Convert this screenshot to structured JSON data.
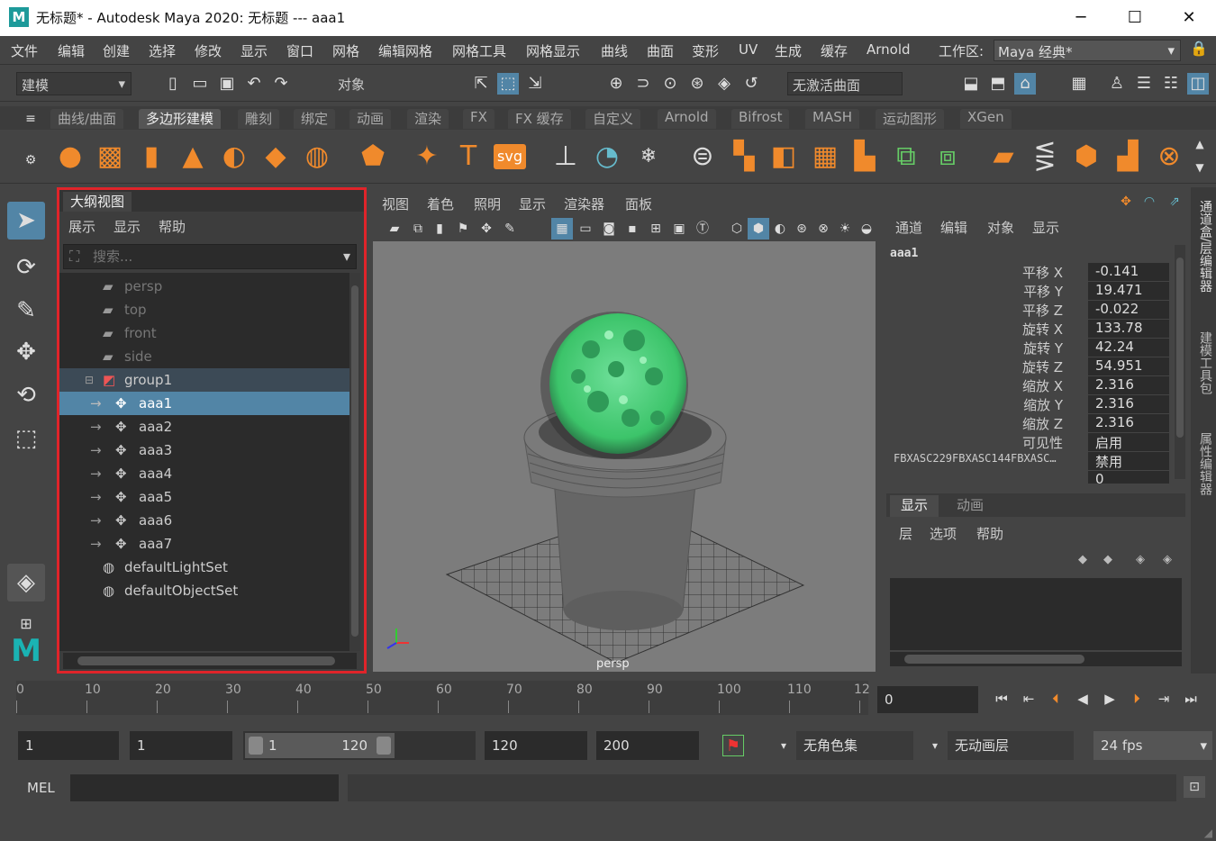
{
  "window": {
    "title": "无标题* - Autodesk Maya 2020: 无标题   ---    aaa1",
    "logo": "M",
    "minimize": "─",
    "maximize": "☐",
    "close": "✕"
  },
  "menus": [
    "文件",
    "编辑",
    "创建",
    "选择",
    "修改",
    "显示",
    "窗口",
    "网格",
    "编辑网格",
    "网格工具",
    "网格显示",
    "曲线",
    "曲面",
    "变形",
    "UV",
    "生成",
    "缓存",
    "Arnold"
  ],
  "workspace": {
    "label": "工作区:",
    "value": "Maya 经典*"
  },
  "toolbar": {
    "mode": "建模",
    "object_mode": "对象",
    "live_surface": "无激活曲面"
  },
  "shelf_tabs": [
    "曲线/曲面",
    "多边形建模",
    "雕刻",
    "绑定",
    "动画",
    "渲染",
    "FX",
    "FX 缓存",
    "自定义",
    "Arnold",
    "Bifrost",
    "MASH",
    "运动图形",
    "XGen"
  ],
  "shelf_active": "多边形建模",
  "outliner": {
    "title": "大纲视图",
    "menu": [
      "展示",
      "显示",
      "帮助"
    ],
    "search_placeholder": "搜索...",
    "items": [
      "persp",
      "top",
      "front",
      "side",
      "group1",
      "aaa1",
      "aaa2",
      "aaa3",
      "aaa4",
      "aaa5",
      "aaa6",
      "aaa7",
      "defaultLightSet",
      "defaultObjectSet"
    ]
  },
  "viewport": {
    "menu": [
      "视图",
      "着色",
      "照明",
      "显示",
      "渲染器",
      "面板"
    ],
    "camera_label": "persp"
  },
  "channel_box": {
    "menu": [
      "通道",
      "编辑",
      "对象",
      "显示"
    ],
    "object": "aaa1",
    "channels": [
      {
        "label": "平移 X",
        "value": "-0.141"
      },
      {
        "label": "平移 Y",
        "value": "19.471"
      },
      {
        "label": "平移 Z",
        "value": "-0.022"
      },
      {
        "label": "旋转 X",
        "value": "133.78"
      },
      {
        "label": "旋转 Y",
        "value": "42.24"
      },
      {
        "label": "旋转 Z",
        "value": "54.951"
      },
      {
        "label": "缩放 X",
        "value": "2.316"
      },
      {
        "label": "缩放 Y",
        "value": "2.316"
      },
      {
        "label": "缩放 Z",
        "value": "2.316"
      },
      {
        "label": "可见性",
        "value": "启用"
      },
      {
        "label": "FBXASC229FBXASC144FBXASC…",
        "value": "禁用"
      },
      {
        "label": "",
        "value": "0"
      }
    ]
  },
  "layer_editor": {
    "tabs": [
      "显示",
      "动画"
    ],
    "menu": [
      "层",
      "选项",
      "帮助"
    ]
  },
  "right_strip": [
    "通道盒/层编辑器",
    "建模工具包",
    "属性编辑器"
  ],
  "timeline": {
    "ticks": [
      "0",
      "10",
      "20",
      "30",
      "40",
      "50",
      "60",
      "70",
      "80",
      "90",
      "100",
      "110",
      "12"
    ],
    "current_frame": "0"
  },
  "range": {
    "start": "1",
    "playback_start": "1",
    "slider_start": "1",
    "slider_end": "120",
    "playback_end": "120",
    "end": "200",
    "character_set": "无角色集",
    "anim_layer": "无动画层",
    "fps": "24 fps"
  },
  "command": {
    "lang": "MEL"
  }
}
